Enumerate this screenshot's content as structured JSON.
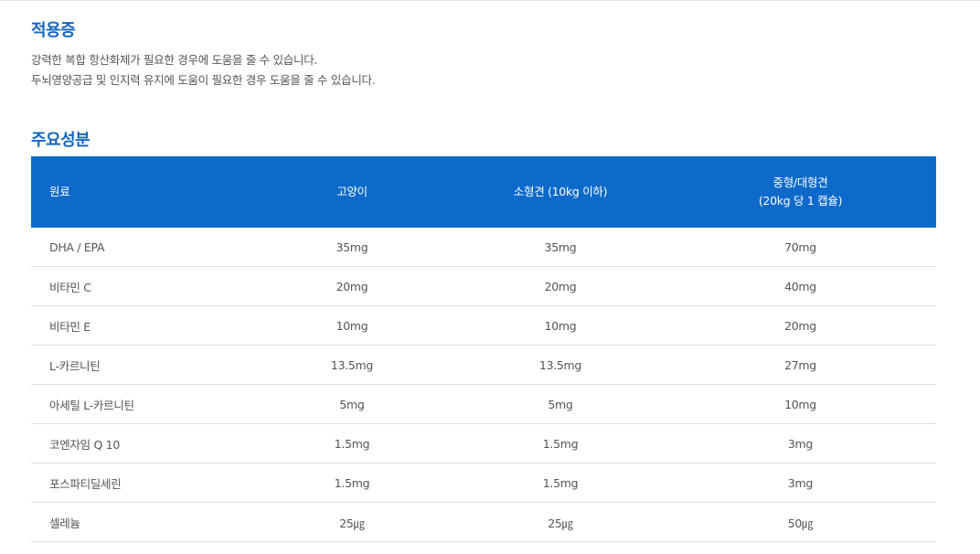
{
  "indications": {
    "title": "적용증",
    "lines": [
      "강력한 복합 항산화제가 필요한 경우에 도움을 줄 수 있습니다.",
      "두뇌영양공급 및 인지력 유지에 도움이 필요한 경우 도움을 줄 수 있습니다."
    ]
  },
  "ingredients": {
    "title": "주요성분",
    "header": {
      "col1": "원료",
      "col2": "고양이",
      "col3": "소형견 (10kg 이하)",
      "col4_line1": "중형/대형견",
      "col4_line2": "(20kg 당 1 캡슐)"
    },
    "rows": [
      [
        "DHA / EPA",
        "35mg",
        "35mg",
        "70mg"
      ],
      [
        "비타민 C",
        "20mg",
        "20mg",
        "40mg"
      ],
      [
        "비타민 E",
        "10mg",
        "10mg",
        "20mg"
      ],
      [
        "L-카르니틴",
        "13.5mg",
        "13.5mg",
        "27mg"
      ],
      [
        "아세틸 L-카르니틴",
        "5mg",
        "5mg",
        "10mg"
      ],
      [
        "코엔자임 Q 10",
        "1.5mg",
        "1.5mg",
        "3mg"
      ],
      [
        "포스파티딜세린",
        "1.5mg",
        "1.5mg",
        "3mg"
      ],
      [
        "셀레늄",
        "25㎍",
        "25㎍",
        "50㎍"
      ]
    ]
  },
  "colors": {
    "accent": "#1565c0",
    "header_bg": "#0d6acb",
    "row_border": "#dddddd",
    "body_text": "#555555"
  }
}
